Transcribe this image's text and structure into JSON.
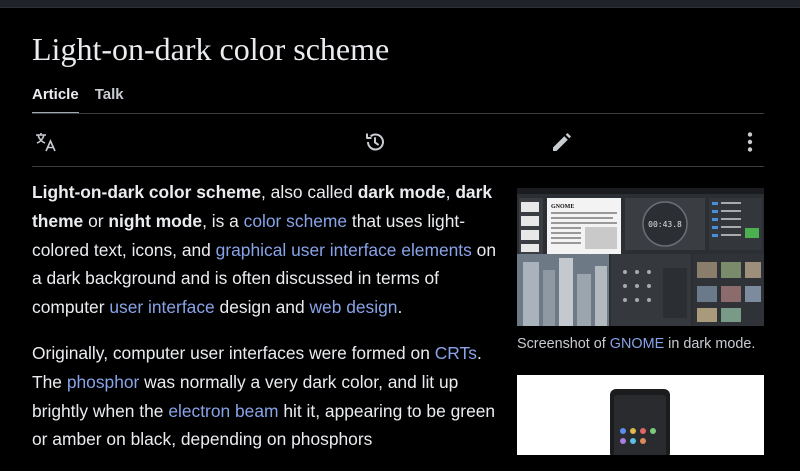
{
  "article": {
    "title": "Light-on-dark color scheme",
    "tabs": [
      {
        "label": "Article",
        "active": true
      },
      {
        "label": "Talk",
        "active": false
      }
    ]
  },
  "toolbar": {
    "icons": [
      "language-icon",
      "history-icon",
      "edit-pencil-icon",
      "more-options-icon"
    ]
  },
  "paragraph1": {
    "t1": "Light-on-dark color scheme",
    "t2": ", also called ",
    "t3": "dark mode",
    "t4": ", ",
    "t5": "dark theme",
    "t6": " or ",
    "t7": "night mode",
    "t8": ", is a ",
    "link1": "color scheme",
    "t9": " that uses light-colored text, icons, and ",
    "link2": "graphical user interface elements",
    "t10": " on a dark background and is often discussed in terms of computer ",
    "link3": "user interface",
    "t11": " design and ",
    "link4": "web design",
    "t12": "."
  },
  "paragraph2": {
    "t1": "Originally, computer user interfaces were formed on ",
    "link1": "CRTs",
    "t2": ". The ",
    "link2": "phosphor",
    "t3": " was normally a very dark color, and lit up brightly when the ",
    "link3": "electron beam",
    "t4": " hit it, appearing to be green or amber on black, depending on phosphors"
  },
  "figure1": {
    "caption_pre": "Screenshot of ",
    "caption_link": "GNOME",
    "caption_post": " in dark mode.",
    "doc_heading": "GNOME",
    "timer": "00:43.8"
  },
  "colors": {
    "background": "#000000",
    "text": "#eaecf0",
    "link": "#88a3e8"
  }
}
